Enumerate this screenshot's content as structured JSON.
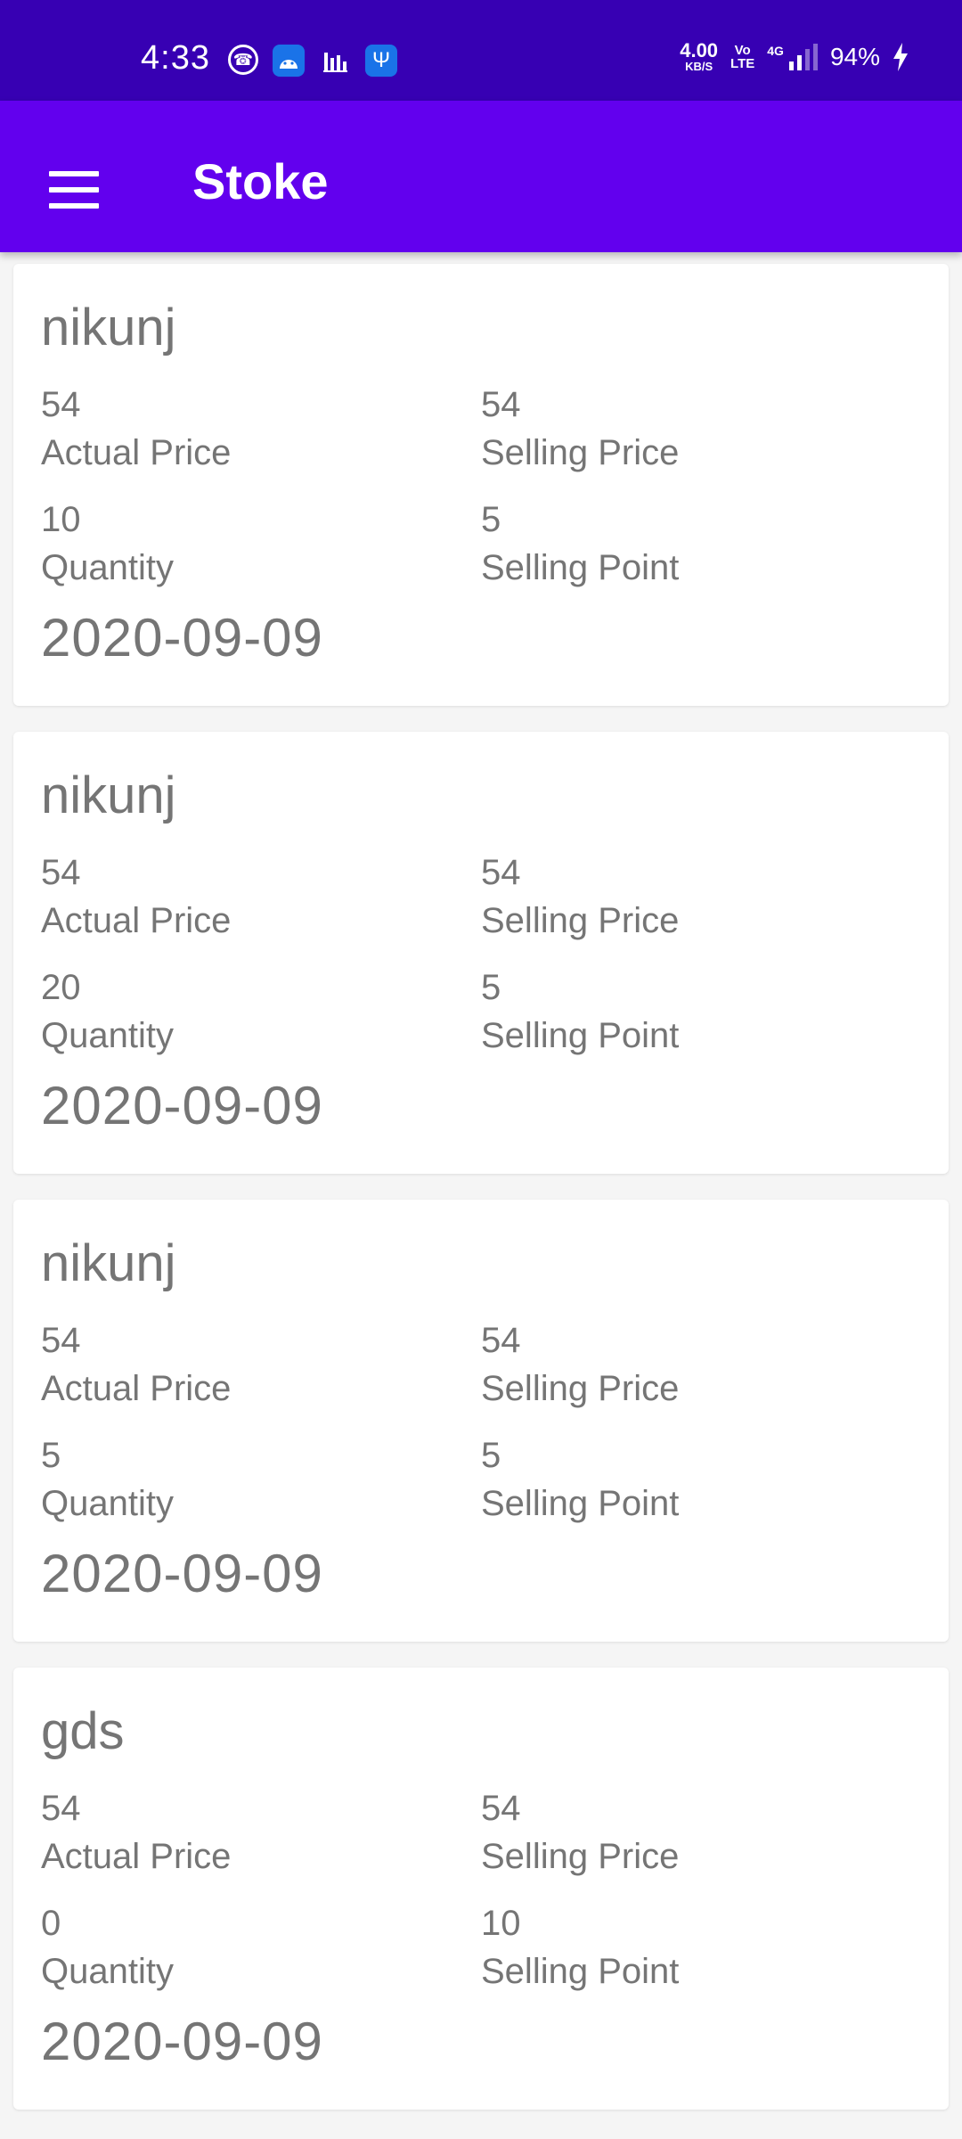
{
  "status_bar": {
    "time": "4:33",
    "left_icons": [
      "whatsapp-icon",
      "android-debug-icon",
      "bar-chart-icon",
      "usb-icon"
    ],
    "net_speed_value": "4.00",
    "net_speed_unit": "KB/S",
    "volte_top": "Vo",
    "volte_bottom": "LTE",
    "network_type": "4G",
    "battery": "94%",
    "colors": {
      "background": "#3700b3"
    }
  },
  "app_bar": {
    "title": "Stoke",
    "menu_icon": "hamburger-menu-icon",
    "colors": {
      "background": "#6200ee"
    }
  },
  "stock_items": [
    {
      "name": "nikunj",
      "actual_price": "54",
      "actual_price_label": "Actual Price",
      "selling_price": "54",
      "selling_price_label": "Selling Price",
      "quantity": "10",
      "quantity_label": "Quantity",
      "selling_point": "5",
      "selling_point_label": "Selling Point",
      "date": "2020-09-09"
    },
    {
      "name": "nikunj",
      "actual_price": "54",
      "actual_price_label": "Actual Price",
      "selling_price": "54",
      "selling_price_label": "Selling Price",
      "quantity": "20",
      "quantity_label": "Quantity",
      "selling_point": "5",
      "selling_point_label": "Selling Point",
      "date": "2020-09-09"
    },
    {
      "name": "nikunj",
      "actual_price": "54",
      "actual_price_label": "Actual Price",
      "selling_price": "54",
      "selling_price_label": "Selling Price",
      "quantity": "5",
      "quantity_label": "Quantity",
      "selling_point": "5",
      "selling_point_label": "Selling Point",
      "date": "2020-09-09"
    },
    {
      "name": "gds",
      "actual_price": "54",
      "actual_price_label": "Actual Price",
      "selling_price": "54",
      "selling_price_label": "Selling Price",
      "quantity": "0",
      "quantity_label": "Quantity",
      "selling_point": "10",
      "selling_point_label": "Selling Point",
      "date": "2020-09-09"
    }
  ]
}
